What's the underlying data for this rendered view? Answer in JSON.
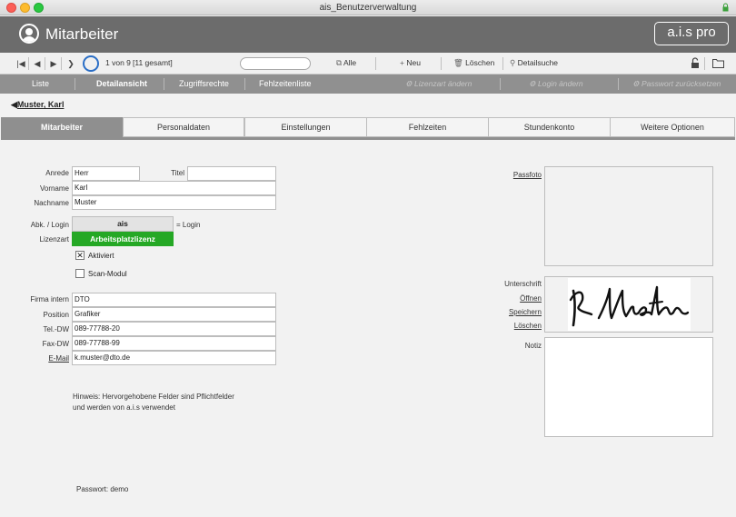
{
  "window": {
    "title": "ais_Benutzerverwaltung"
  },
  "header": {
    "title": "Mitarbeiter",
    "logo": "a.i.s pro"
  },
  "toolbar": {
    "record_info": "1 von 9",
    "total_info": "[11 gesamt]",
    "search_value": "",
    "all_label": "Alle",
    "new_label": "Neu",
    "delete_label": "Löschen",
    "detail_search_label": "Detailsuche"
  },
  "menubar": {
    "items": [
      "Liste",
      "Detailansicht",
      "Zugriffsrechte",
      "Fehlzeitenliste"
    ],
    "actions": [
      "Lizenzart ändern",
      "Login ändern",
      "Passwort zurücksetzen"
    ]
  },
  "breadcrumb": "Muster, Karl",
  "tabs": [
    "Mitarbeiter",
    "Personaldaten",
    "Einstellungen",
    "Fehlzeiten",
    "Stundenkonto",
    "Weitere Optionen"
  ],
  "form": {
    "labels": {
      "anrede": "Anrede",
      "titel": "Titel",
      "vorname": "Vorname",
      "nachname": "Nachname",
      "login": "Abk. / Login",
      "login_suffix": "= Login",
      "lizenzart": "Lizenzart",
      "aktiviert": "Aktiviert",
      "scan": "Scan-Modul",
      "firma": "Firma intern",
      "position": "Position",
      "tel": "Tel.-DW",
      "fax": "Fax-DW",
      "email": "E-Mail"
    },
    "values": {
      "anrede": "Herr",
      "titel": "",
      "vorname": "Karl",
      "nachname": "Muster",
      "login": "ais",
      "lizenzart": "Arbeitsplatzlizenz",
      "firma": "DTO",
      "position": "Grafiker",
      "tel": "089-77788-20",
      "fax": "089-77788-99",
      "email": "k.muster@dto.de"
    },
    "aktiviert_checked": true,
    "scan_checked": false
  },
  "right": {
    "passfoto": "Passfoto",
    "unterschrift": "Unterschrift",
    "oeffnen": "Öffnen",
    "speichern": "Speichern",
    "loeschen": "Löschen",
    "notiz": "Notiz"
  },
  "note": {
    "line1": "Hinweis: Hervorgehobene Felder sind Pflichtfelder",
    "line2": "und werden von a.i.s verwendet"
  },
  "password_hint": "Passwort: demo",
  "colors": {
    "header": "#6c6c6c",
    "menubar": "#909090",
    "active_tab": "#8f8f8f",
    "license_green": "#25a825",
    "spinner_blue": "#2a6ec6"
  }
}
